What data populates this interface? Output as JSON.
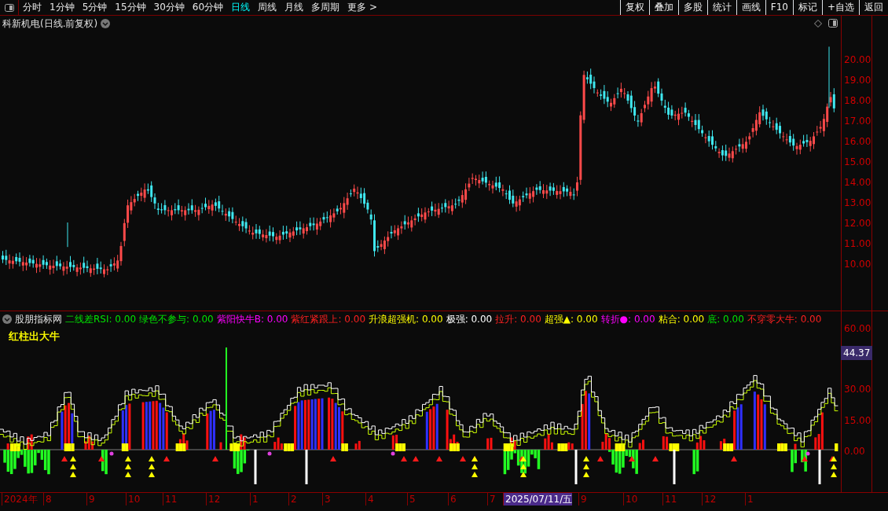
{
  "toolbar": {
    "periods": [
      {
        "label": "分时",
        "selected": false
      },
      {
        "label": "1分钟",
        "selected": false
      },
      {
        "label": "5分钟",
        "selected": false
      },
      {
        "label": "15分钟",
        "selected": false
      },
      {
        "label": "30分钟",
        "selected": false
      },
      {
        "label": "60分钟",
        "selected": false
      },
      {
        "label": "日线",
        "selected": true
      },
      {
        "label": "周线",
        "selected": false
      },
      {
        "label": "月线",
        "selected": false
      },
      {
        "label": "多周期",
        "selected": false
      },
      {
        "label": "更多 >",
        "selected": false
      }
    ],
    "buttons": [
      "复权",
      "叠加",
      "多股",
      "统计",
      "画线",
      "F10",
      "标记",
      "+自选",
      "返回"
    ]
  },
  "price_chart": {
    "title": "科新机电(日线.前复权)",
    "y_labels": [
      "20.00",
      "19.00",
      "18.00",
      "17.00",
      "16.00",
      "15.00",
      "14.00",
      "13.00",
      "12.00",
      "11.00",
      "10.00"
    ]
  },
  "indicator": {
    "name": "股朋指标网",
    "legend": [
      {
        "text": "二线差RSI: 0.00",
        "color": "#00e400"
      },
      {
        "text": "绿色不参与: 0.00",
        "color": "#00e400"
      },
      {
        "text": "紫阳快牛B: 0.00",
        "color": "#ff00ff"
      },
      {
        "text": "紫红紧跟上: 0.00",
        "color": "#ff2020"
      },
      {
        "text": "升浪超强机: 0.00",
        "color": "#ffff00"
      },
      {
        "text": "极强: 0.00",
        "color": "#ffffff"
      },
      {
        "text": "拉升: 0.00",
        "color": "#ff2020"
      },
      {
        "text": "超强▲: 0.00",
        "color": "#ffff00"
      },
      {
        "text": "转折●: 0.00",
        "color": "#ff00ff"
      },
      {
        "text": "粘合: 0.00",
        "color": "#ffff00"
      },
      {
        "text": "底: 0.00",
        "color": "#00e400"
      },
      {
        "text": "不穿零大牛: 0.00",
        "color": "#ff2020"
      },
      {
        "text": "红柱出大牛",
        "color": "#ffff00"
      }
    ],
    "y_labels": [
      "60.00",
      "30.00",
      "15.00",
      "0.00"
    ],
    "current_value": "44.37"
  },
  "date_axis": [
    {
      "label": "2024年",
      "selected": false
    },
    {
      "label": "8",
      "selected": false
    },
    {
      "label": "9",
      "selected": false
    },
    {
      "label": "10",
      "selected": false
    },
    {
      "label": "11",
      "selected": false
    },
    {
      "label": "12",
      "selected": false
    },
    {
      "label": "1",
      "selected": false
    },
    {
      "label": "2",
      "selected": false
    },
    {
      "label": "3",
      "selected": false
    },
    {
      "label": "4",
      "selected": false
    },
    {
      "label": "5",
      "selected": false
    },
    {
      "label": "6",
      "selected": false
    },
    {
      "label": "7",
      "selected": false
    },
    {
      "label": "2025/07/11/五",
      "selected": true
    },
    {
      "label": "9",
      "selected": false
    },
    {
      "label": "10",
      "selected": false
    },
    {
      "label": "11",
      "selected": false
    },
    {
      "label": "12",
      "selected": false
    },
    {
      "label": "1",
      "selected": false
    }
  ]
}
